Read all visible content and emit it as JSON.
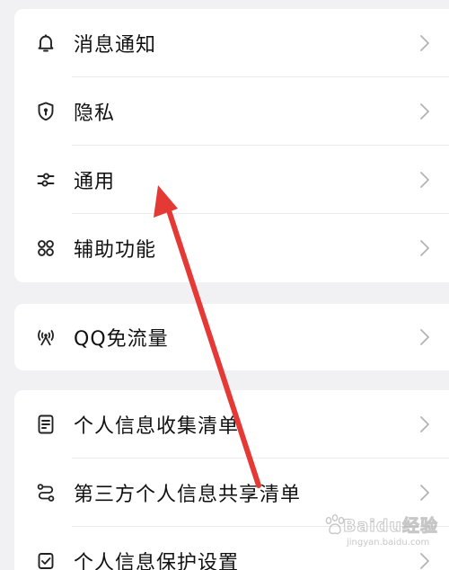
{
  "groups": [
    {
      "items": [
        {
          "label": "消息通知",
          "icon": "bell-icon"
        },
        {
          "label": "隐私",
          "icon": "shield-lock-icon"
        },
        {
          "label": "通用",
          "icon": "sliders-icon"
        },
        {
          "label": "辅助功能",
          "icon": "grid-circles-icon"
        }
      ]
    },
    {
      "items": [
        {
          "label": "QQ免流量",
          "icon": "signal-tower-icon"
        }
      ]
    },
    {
      "items": [
        {
          "label": "个人信息收集清单",
          "icon": "document-list-icon"
        },
        {
          "label": "第三方个人信息共享清单",
          "icon": "share-flow-icon"
        },
        {
          "label": "个人信息保护设置",
          "icon": "protect-settings-icon"
        }
      ]
    }
  ],
  "annotation": {
    "color": "#e53935"
  },
  "watermark": {
    "brand": "Baidu经验",
    "url": "jingyan.baidu.com"
  }
}
